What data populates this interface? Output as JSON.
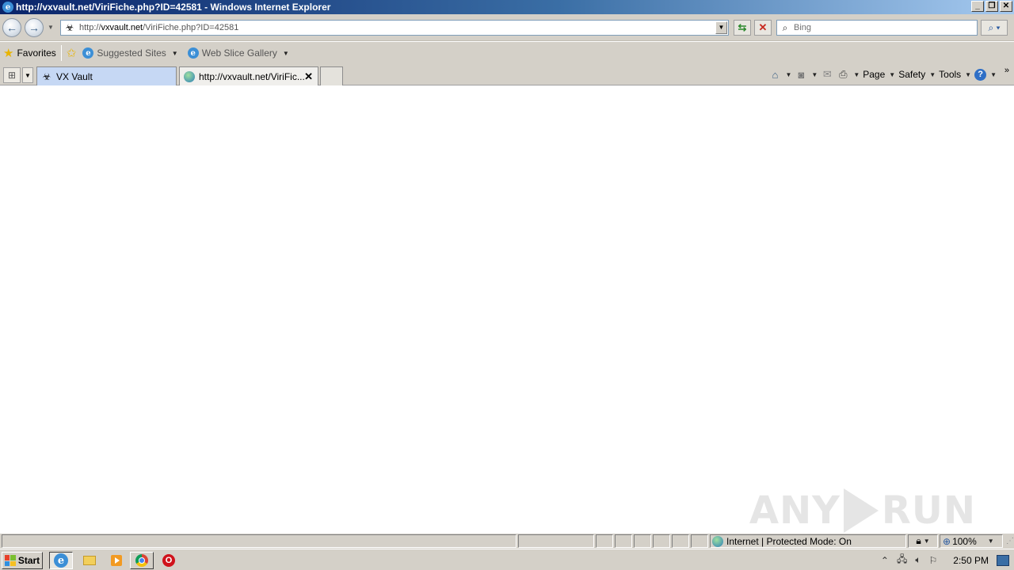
{
  "window": {
    "title": "http://vxvault.net/ViriFiche.php?ID=42581 - Windows Internet Explorer",
    "minimize": "_",
    "restore": "❐",
    "close": "✕"
  },
  "addressbar": {
    "url_prefix": "http://",
    "url_host": "vxvault.net",
    "url_path": "/ViriFiche.php?ID=42581",
    "search_placeholder": "Bing"
  },
  "favorites": {
    "label": "Favorites",
    "suggested_sites": "Suggested Sites",
    "web_slice_gallery": "Web Slice Gallery"
  },
  "tabs": [
    {
      "label": "VX Vault",
      "active": false
    },
    {
      "label": "http://vxvault.net/ViriFic...",
      "active": true
    }
  ],
  "commandbar": {
    "page": "Page",
    "safety": "Safety",
    "tools": "Tools"
  },
  "statusbar": {
    "zone": "Internet | Protected Mode: On",
    "zoom": "100%"
  },
  "taskbar": {
    "start": "Start",
    "time": "2:50 PM"
  },
  "watermark": {
    "left": "ANY",
    "right": "RUN"
  },
  "colors": {
    "titlebar_start": "#0a246a",
    "titlebar_end": "#a6caf0",
    "chrome_bg": "#d4d0c8",
    "active_tab": "#c6d8f4"
  }
}
